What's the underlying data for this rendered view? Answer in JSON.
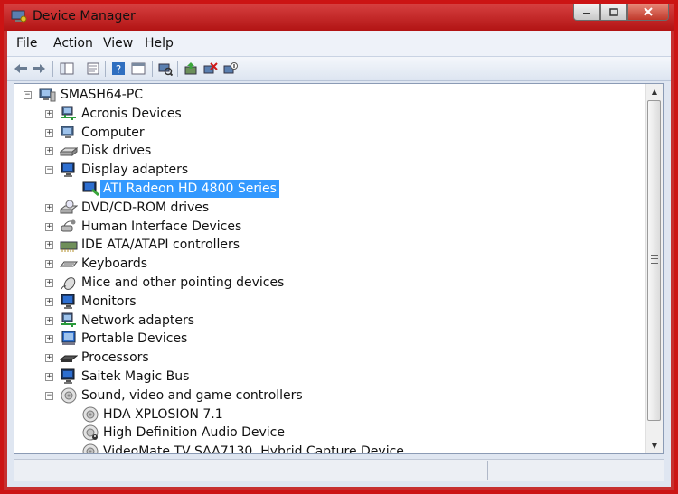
{
  "window": {
    "title": "Device Manager"
  },
  "menu": [
    "File",
    "Action",
    "View",
    "Help"
  ],
  "toolbar": {
    "icons": [
      "back-icon",
      "forward-icon",
      "show-hide-tree-icon",
      "properties-icon",
      "help-icon",
      "view-icon",
      "scan-hardware-icon",
      "update-driver-icon",
      "uninstall-icon",
      "disable-icon"
    ]
  },
  "tree": {
    "root": "SMASH64-PC",
    "items": [
      {
        "label": "Acronis Devices",
        "icon": "network-adapter-icon",
        "level": 1,
        "expander": "+"
      },
      {
        "label": "Computer",
        "icon": "computer-icon",
        "level": 1,
        "expander": "+"
      },
      {
        "label": "Disk drives",
        "icon": "disk-drive-icon",
        "level": 1,
        "expander": "+"
      },
      {
        "label": "Display adapters",
        "icon": "monitor-icon",
        "level": 1,
        "expander": "-"
      },
      {
        "label": "ATI Radeon HD 4800 Series",
        "icon": "display-adapter-icon",
        "level": 2,
        "selected": true
      },
      {
        "label": "DVD/CD-ROM drives",
        "icon": "dvd-drive-icon",
        "level": 1,
        "expander": "+"
      },
      {
        "label": "Human Interface Devices",
        "icon": "hid-icon",
        "level": 1,
        "expander": "+"
      },
      {
        "label": "IDE ATA/ATAPI controllers",
        "icon": "ide-controller-icon",
        "level": 1,
        "expander": "+"
      },
      {
        "label": "Keyboards",
        "icon": "keyboard-icon",
        "level": 1,
        "expander": "+"
      },
      {
        "label": "Mice and other pointing devices",
        "icon": "mouse-icon",
        "level": 1,
        "expander": "+"
      },
      {
        "label": "Monitors",
        "icon": "monitor-icon",
        "level": 1,
        "expander": "+"
      },
      {
        "label": "Network adapters",
        "icon": "network-adapter-icon",
        "level": 1,
        "expander": "+"
      },
      {
        "label": "Portable Devices",
        "icon": "portable-device-icon",
        "level": 1,
        "expander": "+"
      },
      {
        "label": "Processors",
        "icon": "processor-icon",
        "level": 1,
        "expander": "+"
      },
      {
        "label": "Saitek Magic Bus",
        "icon": "monitor-icon",
        "level": 1,
        "expander": "+"
      },
      {
        "label": "Sound, video and game controllers",
        "icon": "speaker-icon",
        "level": 1,
        "expander": "-"
      },
      {
        "label": "HDA XPLOSION 7.1",
        "icon": "speaker-icon",
        "level": 2
      },
      {
        "label": "High Definition Audio Device",
        "icon": "speaker-warning-icon",
        "level": 2
      },
      {
        "label": "VideoMate TV SAA7130, Hybrid Capture Device",
        "icon": "speaker-icon",
        "level": 2
      }
    ]
  },
  "colors": {
    "frame": "#cc1414",
    "selection": "#3399ff",
    "menubar": "#eef2f9"
  }
}
